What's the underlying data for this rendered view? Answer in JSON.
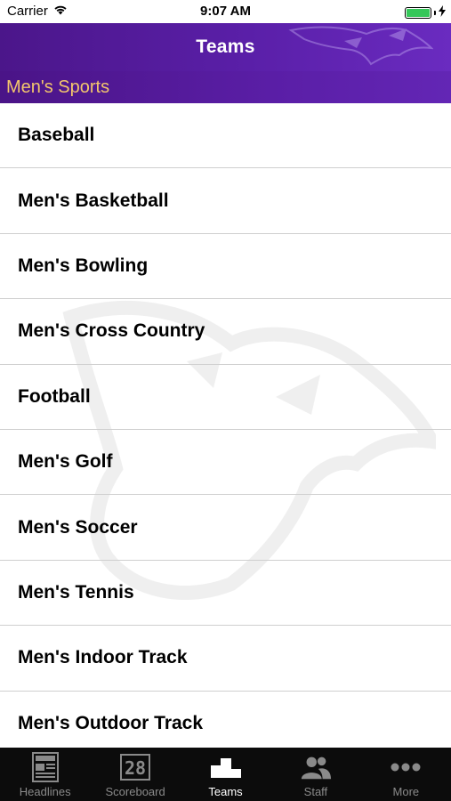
{
  "status_bar": {
    "carrier": "Carrier",
    "time": "9:07 AM",
    "battery_level": 1.0
  },
  "nav": {
    "title": "Teams"
  },
  "section": {
    "title": "Men's Sports"
  },
  "teams": [
    "Baseball",
    "Men's Basketball",
    "Men's Bowling",
    "Men's Cross Country",
    "Football",
    "Men's Golf",
    "Men's Soccer",
    "Men's Tennis",
    "Men's Indoor Track",
    "Men's Outdoor Track"
  ],
  "tabs": [
    {
      "label": "Headlines",
      "icon": "newspaper-icon",
      "active": false
    },
    {
      "label": "Scoreboard",
      "icon": "scoreboard-icon",
      "active": false
    },
    {
      "label": "Teams",
      "icon": "podium-icon",
      "active": true
    },
    {
      "label": "Staff",
      "icon": "people-icon",
      "active": false
    },
    {
      "label": "More",
      "icon": "more-dots-icon",
      "active": false
    }
  ],
  "scoreboard_digits": "28",
  "colors": {
    "nav_purple": "#5a1fa8",
    "section_text": "#f3c66c",
    "battery": "#35c759",
    "tab_bar": "#0c0c0c"
  }
}
